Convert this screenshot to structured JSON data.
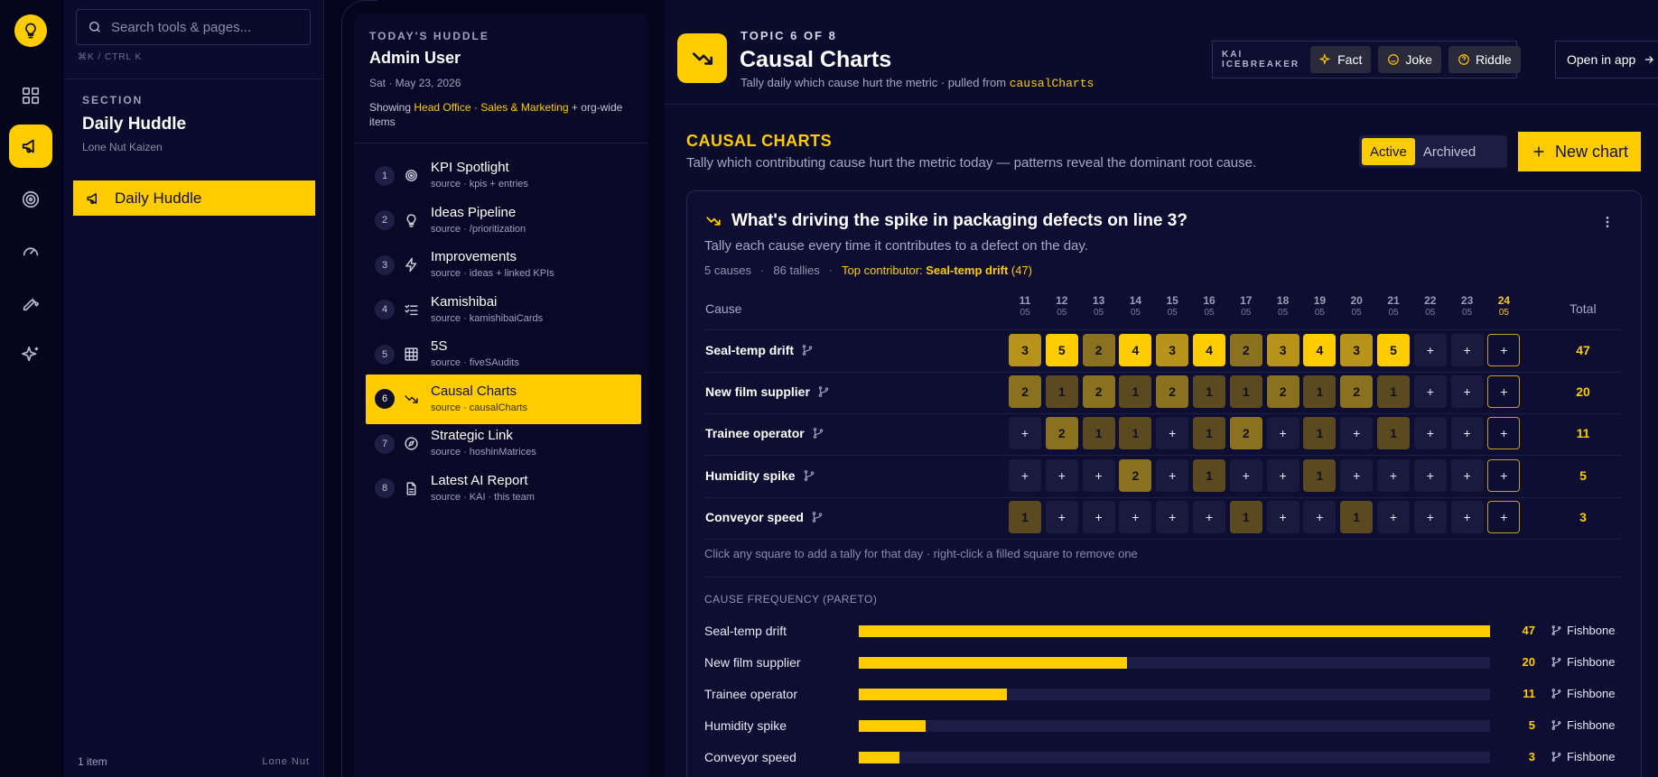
{
  "colors": {
    "accent": "#ffcc00",
    "background": "#04041c",
    "panel": "#0b0b2d"
  },
  "rail": {
    "items": [
      {
        "icon": "grid-icon",
        "active": false
      },
      {
        "icon": "megaphone-icon",
        "active": true
      },
      {
        "icon": "target-icon",
        "active": false
      },
      {
        "icon": "gauge-icon",
        "active": false
      },
      {
        "icon": "wrench-icon",
        "active": false
      },
      {
        "icon": "sparkle-icon",
        "active": false
      }
    ]
  },
  "section_panel": {
    "search_placeholder": "Search tools & pages...",
    "shortcut": "⌘K / CTRL K",
    "section_label": "SECTION",
    "section_title": "Daily Huddle",
    "section_org": "Lone Nut Kaizen",
    "nav_item": "Daily Huddle",
    "footer_count": "1 item",
    "footer_org": "Lone  Nut"
  },
  "huddle": {
    "label": "TODAY'S HUDDLE",
    "user": "Admin User",
    "date": "Sat · May 23, 2026",
    "showing_prefix": "Showing ",
    "showing_office": "Head Office",
    "showing_sep": " · ",
    "showing_team": "Sales & Marketing",
    "showing_suffix": " + org-wide items",
    "topics": [
      {
        "num": "1",
        "title": "KPI Spotlight",
        "source": "source · kpis + entries",
        "icon": "target-icon"
      },
      {
        "num": "2",
        "title": "Ideas Pipeline",
        "source": "source · /prioritization",
        "icon": "lightbulb-icon"
      },
      {
        "num": "3",
        "title": "Improvements",
        "source": "source · ideas + linked KPIs",
        "icon": "bolt-icon"
      },
      {
        "num": "4",
        "title": "Kamishibai",
        "source": "source · kamishibaiCards",
        "icon": "checklist-icon"
      },
      {
        "num": "5",
        "title": "5S",
        "source": "source · fiveSAudits",
        "icon": "table-icon"
      },
      {
        "num": "6",
        "title": "Causal Charts",
        "source": "source · causalCharts",
        "icon": "trend-down-icon"
      },
      {
        "num": "7",
        "title": "Strategic Link",
        "source": "source · hoshinMatrices",
        "icon": "compass-icon"
      },
      {
        "num": "8",
        "title": "Latest AI Report",
        "source": "source · KAI · this team",
        "icon": "document-icon"
      }
    ]
  },
  "header": {
    "kicker": "TOPIC 6 OF 8",
    "title": "Causal Charts",
    "subtitle_prefix": "Tally daily which cause hurt the metric · pulled from ",
    "subtitle_code": "causalCharts",
    "kai_label": "KAI ICEBREAKER",
    "kai_fact": "Fact",
    "kai_joke": "Joke",
    "kai_riddle": "Riddle",
    "open_app": "Open in app"
  },
  "charts_section": {
    "title": "CAUSAL CHARTS",
    "subtitle": "Tally which contributing cause hurt the metric today — patterns reveal the dominant root cause.",
    "tab_active": "Active",
    "tab_archived": "Archived",
    "new_chart": "New chart"
  },
  "chart": {
    "question": "What's driving the spike in packaging defects on line 3?",
    "description": "Tally each cause every time it contributes to a defect on the day.",
    "causes_count": "5 causes",
    "tallies_count": "86 tallies",
    "top_prefix": "Top contributor: ",
    "top_name": "Seal-temp drift",
    "top_count": " (47)",
    "cause_header": "Cause",
    "total_header": "Total",
    "empty_mark": "+",
    "days": [
      {
        "day": "11",
        "month": "05"
      },
      {
        "day": "12",
        "month": "05"
      },
      {
        "day": "13",
        "month": "05"
      },
      {
        "day": "14",
        "month": "05"
      },
      {
        "day": "15",
        "month": "05"
      },
      {
        "day": "16",
        "month": "05"
      },
      {
        "day": "17",
        "month": "05"
      },
      {
        "day": "18",
        "month": "05"
      },
      {
        "day": "19",
        "month": "05"
      },
      {
        "day": "20",
        "month": "05"
      },
      {
        "day": "21",
        "month": "05"
      },
      {
        "day": "22",
        "month": "05"
      },
      {
        "day": "23",
        "month": "05"
      },
      {
        "day": "24",
        "month": "05"
      }
    ],
    "rows": [
      {
        "cause": "Seal-temp drift",
        "counts": [
          3,
          5,
          2,
          4,
          3,
          4,
          2,
          3,
          4,
          3,
          5,
          0,
          0,
          0
        ],
        "total": "47"
      },
      {
        "cause": "New film supplier",
        "counts": [
          2,
          1,
          2,
          1,
          2,
          1,
          1,
          2,
          1,
          2,
          1,
          0,
          0,
          0
        ],
        "total": "20"
      },
      {
        "cause": "Trainee operator",
        "counts": [
          0,
          2,
          1,
          1,
          0,
          1,
          2,
          0,
          1,
          0,
          1,
          0,
          0,
          0
        ],
        "total": "11"
      },
      {
        "cause": "Humidity spike",
        "counts": [
          0,
          0,
          0,
          2,
          0,
          1,
          0,
          0,
          1,
          0,
          0,
          0,
          0,
          0
        ],
        "total": "5"
      },
      {
        "cause": "Conveyor speed",
        "counts": [
          1,
          0,
          0,
          0,
          0,
          0,
          1,
          0,
          0,
          1,
          0,
          0,
          0,
          0
        ],
        "total": "3"
      }
    ],
    "hint": "Click any square to add a tally for that day · right-click a filled square to remove one",
    "pareto_title": "CAUSE FREQUENCY (PARETO)",
    "fishbone_label": "Fishbone"
  },
  "chart_data": {
    "type": "bar",
    "categories": [
      "Seal-temp drift",
      "New film supplier",
      "Trainee operator",
      "Humidity spike",
      "Conveyor speed"
    ],
    "values": [
      47,
      20,
      11,
      5,
      3
    ],
    "title": "CAUSE FREQUENCY (PARETO)",
    "xlabel": "",
    "ylabel": "",
    "orientation": "horizontal",
    "xlim": [
      0,
      47
    ]
  }
}
